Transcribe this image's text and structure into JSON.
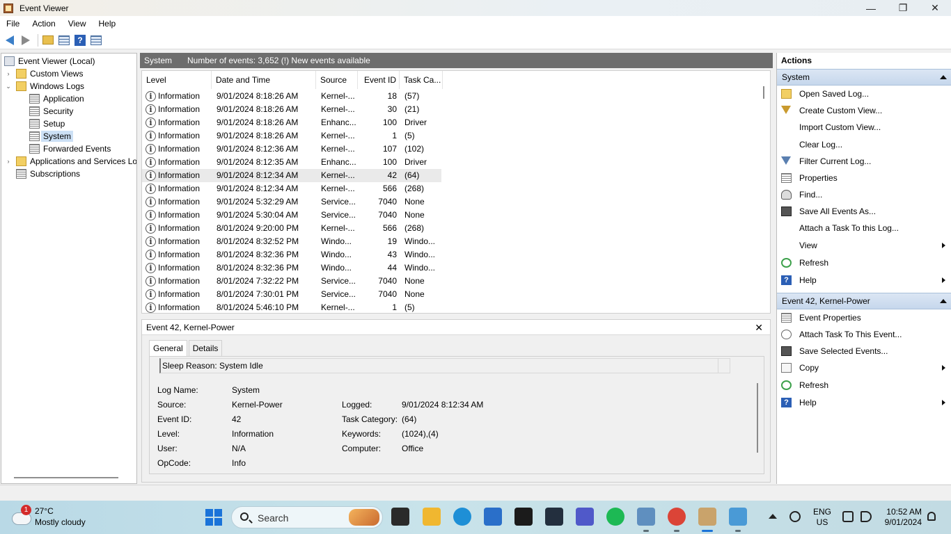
{
  "window": {
    "title": "Event Viewer",
    "controls": [
      "—",
      "❐",
      "✕"
    ]
  },
  "menu": [
    "File",
    "Action",
    "View",
    "Help"
  ],
  "tree": [
    {
      "label": "Event Viewer (Local)",
      "level": 0,
      "icon": "event-viewer-icon",
      "exp": ""
    },
    {
      "label": "Custom Views",
      "level": 1,
      "icon": "folder-icon",
      "exp": "›"
    },
    {
      "label": "Windows Logs",
      "level": 1,
      "icon": "folder-icon",
      "exp": "⌄"
    },
    {
      "label": "Application",
      "level": 2,
      "icon": "log-icon",
      "exp": ""
    },
    {
      "label": "Security",
      "level": 2,
      "icon": "log-icon",
      "exp": ""
    },
    {
      "label": "Setup",
      "level": 2,
      "icon": "log-icon",
      "exp": ""
    },
    {
      "label": "System",
      "level": 2,
      "icon": "log-icon",
      "exp": "",
      "selected": true
    },
    {
      "label": "Forwarded Events",
      "level": 2,
      "icon": "log-icon",
      "exp": ""
    },
    {
      "label": "Applications and Services Lo",
      "level": 1,
      "icon": "folder-icon",
      "exp": "›"
    },
    {
      "label": "Subscriptions",
      "level": 1,
      "icon": "log-icon",
      "exp": ""
    }
  ],
  "center": {
    "title": "System",
    "summary": "Number of events: 3,652 (!) New events available"
  },
  "columns": [
    "Level",
    "Date and Time",
    "Source",
    "Event ID",
    "Task Ca..."
  ],
  "events": [
    [
      "Information",
      "9/01/2024 8:18:26 AM",
      "Kernel-...",
      "18",
      "(57)"
    ],
    [
      "Information",
      "9/01/2024 8:18:26 AM",
      "Kernel-...",
      "30",
      "(21)"
    ],
    [
      "Information",
      "9/01/2024 8:18:26 AM",
      "Enhanc...",
      "100",
      "Driver"
    ],
    [
      "Information",
      "9/01/2024 8:18:26 AM",
      "Kernel-...",
      "1",
      "(5)"
    ],
    [
      "Information",
      "9/01/2024 8:12:36 AM",
      "Kernel-...",
      "107",
      "(102)"
    ],
    [
      "Information",
      "9/01/2024 8:12:35 AM",
      "Enhanc...",
      "100",
      "Driver"
    ],
    [
      "Information",
      "9/01/2024 8:12:34 AM",
      "Kernel-...",
      "42",
      "(64)"
    ],
    [
      "Information",
      "9/01/2024 8:12:34 AM",
      "Kernel-...",
      "566",
      "(268)"
    ],
    [
      "Information",
      "9/01/2024 5:32:29 AM",
      "Service...",
      "7040",
      "None"
    ],
    [
      "Information",
      "9/01/2024 5:30:04 AM",
      "Service...",
      "7040",
      "None"
    ],
    [
      "Information",
      "8/01/2024 9:20:00 PM",
      "Kernel-...",
      "566",
      "(268)"
    ],
    [
      "Information",
      "8/01/2024 8:32:52 PM",
      "Windo...",
      "19",
      "Windo..."
    ],
    [
      "Information",
      "8/01/2024 8:32:36 PM",
      "Windo...",
      "43",
      "Windo..."
    ],
    [
      "Information",
      "8/01/2024 8:32:36 PM",
      "Windo...",
      "44",
      "Windo..."
    ],
    [
      "Information",
      "8/01/2024 7:32:22 PM",
      "Service...",
      "7040",
      "None"
    ],
    [
      "Information",
      "8/01/2024 7:30:01 PM",
      "Service...",
      "7040",
      "None"
    ],
    [
      "Information",
      "8/01/2024 5:46:10 PM",
      "Kernel-...",
      "1",
      "(5)"
    ]
  ],
  "detail": {
    "title": "Event 42, Kernel-Power",
    "close": "✕",
    "tabs": [
      "General",
      "Details"
    ],
    "description": "Sleep Reason: System Idle",
    "fields_left": [
      [
        "Log Name:",
        "System"
      ],
      [
        "Source:",
        "Kernel-Power"
      ],
      [
        "Event ID:",
        "42"
      ],
      [
        "Level:",
        "Information"
      ],
      [
        "User:",
        "N/A"
      ],
      [
        "OpCode:",
        "Info"
      ]
    ],
    "fields_right": [
      [
        "Logged:",
        "9/01/2024 8:12:34 AM"
      ],
      [
        "Task Category:",
        "(64)"
      ],
      [
        "Keywords:",
        "(1024),(4)"
      ],
      [
        "Computer:",
        "Office"
      ]
    ]
  },
  "actions": {
    "title": "Actions",
    "section1": "System",
    "items1": [
      {
        "label": "Open Saved Log...",
        "icon": "folder"
      },
      {
        "label": "Create Custom View...",
        "icon": "funnel"
      },
      {
        "label": "Import Custom View...",
        "icon": ""
      },
      {
        "label": "Clear Log...",
        "icon": ""
      },
      {
        "label": "Filter Current Log...",
        "icon": "funnel-b"
      },
      {
        "label": "Properties",
        "icon": "props"
      },
      {
        "label": "Find...",
        "icon": "find"
      },
      {
        "label": "Save All Events As...",
        "icon": "save"
      },
      {
        "label": "Attach a Task To this Log...",
        "icon": ""
      },
      {
        "label": "View",
        "icon": "",
        "sub": true
      },
      {
        "label": "Refresh",
        "icon": "refresh"
      },
      {
        "label": "Help",
        "icon": "help",
        "sub": true
      }
    ],
    "section2": "Event 42, Kernel-Power",
    "items2": [
      {
        "label": "Event Properties",
        "icon": "props"
      },
      {
        "label": "Attach Task To This Event...",
        "icon": "task"
      },
      {
        "label": "Save Selected Events...",
        "icon": "save"
      },
      {
        "label": "Copy",
        "icon": "copy",
        "sub": true
      },
      {
        "label": "Refresh",
        "icon": "refresh"
      },
      {
        "label": "Help",
        "icon": "help",
        "sub": true
      }
    ]
  },
  "taskbar": {
    "weather_badge": "1",
    "weather_temp": "27°C",
    "weather_cond": "Mostly cloudy",
    "search_label": "Search",
    "lang1": "ENG",
    "lang2": "US",
    "time": "10:52 AM",
    "date": "9/01/2024",
    "apps": [
      {
        "name": "task-view-icon",
        "color": "#2a2a2a"
      },
      {
        "name": "file-explorer-icon",
        "color": "#f0b730"
      },
      {
        "name": "edge-icon",
        "color": "#1e8fd6"
      },
      {
        "name": "store-icon",
        "color": "#2a6fc9"
      },
      {
        "name": "dropbox-icon",
        "color": "#1b1b1b"
      },
      {
        "name": "amazon-icon",
        "color": "#232f3e"
      },
      {
        "name": "teams-icon",
        "color": "#5059c9"
      },
      {
        "name": "spotify-icon",
        "color": "#1db954"
      },
      {
        "name": "control-panel-icon",
        "color": "#5f8fbf"
      },
      {
        "name": "chrome-icon",
        "color": "#db4437"
      },
      {
        "name": "event-viewer-taskbar-icon",
        "color": "#c9a36b"
      },
      {
        "name": "paint-icon",
        "color": "#4a9ad6"
      }
    ]
  }
}
